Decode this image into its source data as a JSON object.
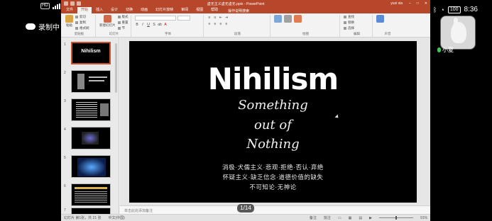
{
  "phone_status": {
    "signal_badges": [
      "HD",
      "HD"
    ],
    "time": "8:36",
    "battery": "100"
  },
  "recording": {
    "label": "录制中"
  },
  "participant": {
    "name": "小夏"
  },
  "ppt": {
    "title": "虚无主义虚无虚无.pptx - PowerPoint",
    "user": "yuxi xia",
    "tabs": [
      "文件",
      "开始",
      "插入",
      "设计",
      "切换",
      "动画",
      "幻灯片放映",
      "审阅",
      "视图",
      "帮助"
    ],
    "active_tab_index": 1,
    "tell_me": "操作说明搜索",
    "ribbon_groups": [
      "剪贴板",
      "幻灯片",
      "字体",
      "段落",
      "绘图",
      "编辑",
      "声音"
    ],
    "clipboard_items": [
      "粘贴",
      "剪切",
      "复制",
      "格式刷"
    ],
    "slides_items": [
      "新建幻灯片",
      "版式",
      "重置",
      "节"
    ],
    "editing_items": [
      "查找",
      "替换",
      "选择"
    ],
    "notes_placeholder": "单击此处添加备注",
    "status_left": "幻灯片 第1张，共 21 张",
    "status_lang": "中文(中国)",
    "status_right": [
      "备注",
      "批注"
    ],
    "zoom": "91%"
  },
  "slide": {
    "title": "Nihilism",
    "subtitle_lines": [
      "Something",
      "out of",
      "Nothing"
    ],
    "cn_lines": [
      "消极·犬儒主义·悲观·拒绝·否认·弃绝",
      "怀疑主义·缺乏信念·道德价值的缺失",
      "不可知论·无神论"
    ]
  },
  "thumbnails": [
    "1",
    "2",
    "3",
    "4",
    "5",
    "6",
    "7"
  ],
  "page_indicator": "1/14"
}
